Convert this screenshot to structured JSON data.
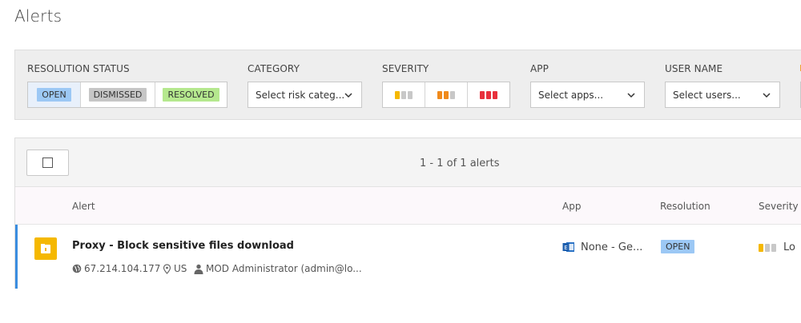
{
  "page": {
    "title": "Alerts"
  },
  "filters": {
    "resolution_status": {
      "label": "RESOLUTION STATUS",
      "options": [
        "OPEN",
        "DISMISSED",
        "RESOLVED"
      ],
      "selected": "OPEN"
    },
    "category": {
      "label": "CATEGORY",
      "placeholder": "Select risk categ..."
    },
    "severity": {
      "label": "SEVERITY",
      "options": [
        "Low",
        "Medium",
        "High"
      ]
    },
    "app": {
      "label": "APP",
      "placeholder": "Select apps..."
    },
    "user_name": {
      "label": "USER NAME",
      "placeholder": "Select users..."
    }
  },
  "results": {
    "count_text": "1 - 1 of 1 alerts",
    "columns": [
      "Alert",
      "App",
      "Resolution",
      "Severity"
    ],
    "rows": [
      {
        "title": "Proxy - Block sensitive files download",
        "ip": "67.214.104.177",
        "location": "US",
        "user": "MOD Administrator (admin@lo...",
        "app": "None - Ge...",
        "resolution": "OPEN",
        "severity": "Lo"
      }
    ]
  },
  "colors": {
    "accent": "#3a8de0",
    "open": "#9cc8f5",
    "dismissed": "#c6c6c6",
    "resolved": "#b5e88e",
    "sev_low": "#f5b800",
    "sev_medium": "#f08a1c",
    "sev_high": "#e8303c",
    "sev_off": "#c8c8c8"
  },
  "icons": {
    "alert": "lock-folder-icon",
    "ip": "globe-icon",
    "location": "location-pin-icon",
    "user": "person-icon",
    "app": "outlook-icon",
    "dropdown": "chevron-down-icon"
  }
}
